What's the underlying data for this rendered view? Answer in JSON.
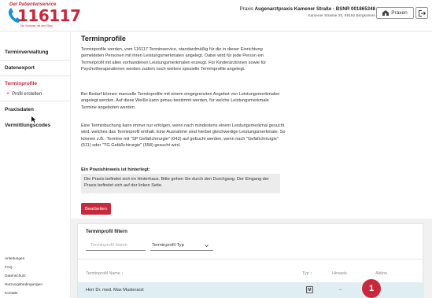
{
  "logo": {
    "top_text": "Der Patientenservice",
    "number": "116117",
    "tagline": "Die Nummer mit den Elfen"
  },
  "header": {
    "practice_prefix": "Praxis",
    "practice_name": "Augenarztpraxis Kamener Straße - BSNR 001865348",
    "practice_address": "Kamener Strasse 25, 59192 Bergkamen",
    "praxen_label": "Praxen"
  },
  "sidebar": {
    "items": [
      {
        "label": "Terminverwaltung"
      },
      {
        "label": "Datenexport"
      },
      {
        "label": "Terminprofile"
      },
      {
        "label": "Profil erstellen"
      },
      {
        "label": "Praxisdaten"
      },
      {
        "label": "Vermittlungscodes"
      }
    ],
    "footer": [
      "Anleitungen",
      "FAQ",
      "Datenschutz",
      "Nutzungsbedingungen",
      "Kontakt"
    ]
  },
  "main": {
    "title": "Terminprofile",
    "paragraphs": [
      "Terminprofile werden, vom 116117 Terminservice, standardmäßig für die in dieser Einrichtung gemeldeten Personen mit ihren Leistungsmerkmalen angelegt. Dabei wird für jede Person ein Terminprofil mit allen vorhandenen Leistungsmerkmalen erzeugt. Für Kinderärztinnen sowie für Psychotherapeutinnen werden zudem noch weitere spezielle Terminprofile angelegt.",
      "Bei Bedarf können manuelle Terminprofile mit einem eingegrenzten Angebot von Leistungsmerkmalen angelegt werden. Auf diese Weiße kann genau bestimmt werden, für welche Leistungsmerkmale Termine angeboten werden.",
      "Eine Terminbuchung kann immer nur erfolgen, wenn nach mindestens einem Leistungsmerkmal gesucht wird, welches das Terminprofil enthält. Eine Ausnahme sind hierbei gleichwertige Leistungsmerkmale. So können z.B.: Termine mit \"SP Gefäßchirurgie\" (043) auf gebucht werden, wenn nach \"Gefäßchirurgie\" (511) oder \"TG Gefäßchirurgie\" (558) gesucht wird."
    ],
    "hint_label": "Ein Praxishinweis ist hinterlegt:",
    "hint_text": "Die Praxis befindet sich im Hinterhaus. Bitte gehen Sie durch den Durchgang. Der Eingang der Praxis befindet sich auf der linken Seite.",
    "edit_button": "Bearbeiten"
  },
  "filter": {
    "title": "Terminprofil filtern",
    "name_placeholder": "Terminprofil Name",
    "type_label": "Terminprofil Typ"
  },
  "table": {
    "columns": [
      "Terminprofil Name ↕",
      "Typ ↕",
      "Hinweis",
      "Aktion"
    ],
    "rows": [
      {
        "name": "Herr Dr. med. Max Musterarzt",
        "type": "M",
        "hint": "–"
      }
    ]
  },
  "annotation": {
    "marker": "1"
  },
  "colors": {
    "accent": "#c8283c",
    "row_highlight": "#dfeef2",
    "panel_bg": "#f1f1f1"
  }
}
